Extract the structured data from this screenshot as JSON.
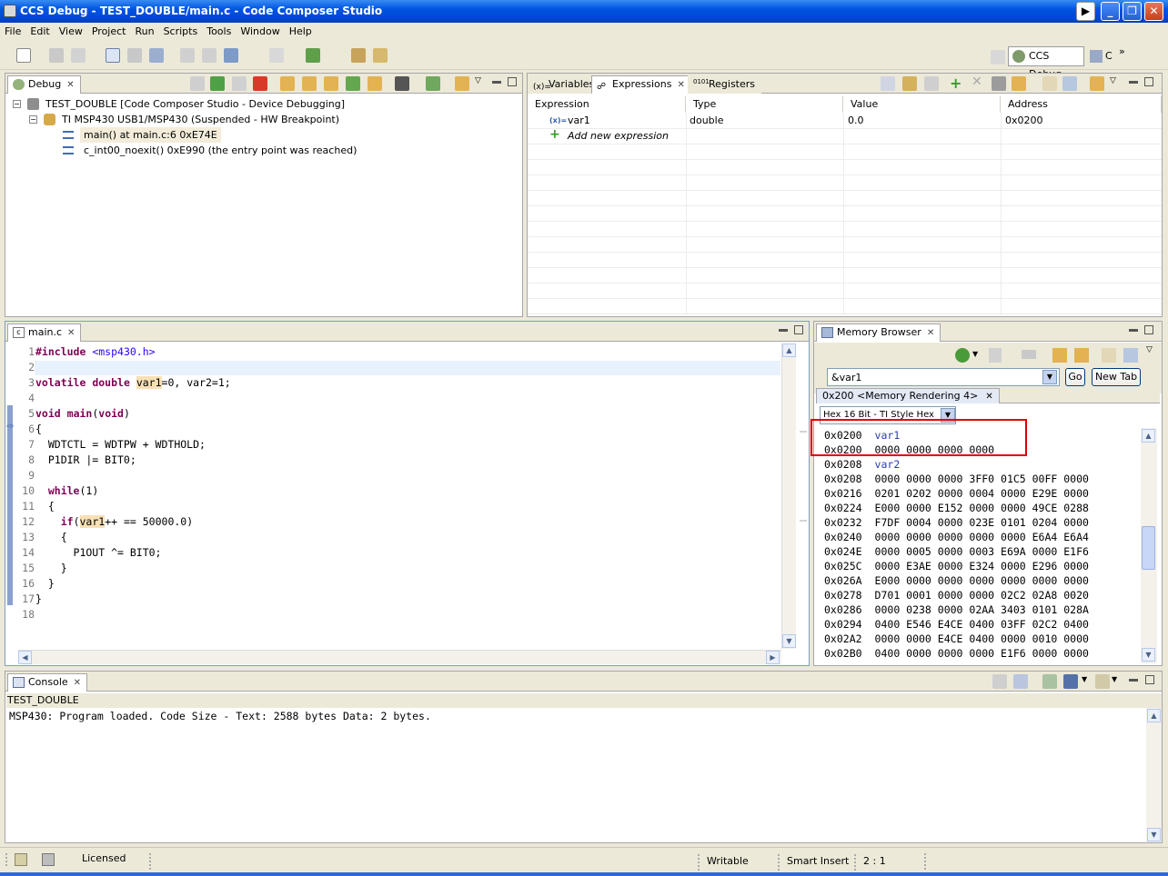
{
  "window": {
    "title": "CCS Debug - TEST_DOUBLE/main.c - Code Composer Studio"
  },
  "menu": [
    "File",
    "Edit",
    "View",
    "Project",
    "Run",
    "Scripts",
    "Tools",
    "Window",
    "Help"
  ],
  "perspective": {
    "label": "CCS Debug",
    "overflow": "C"
  },
  "debug": {
    "tab": "Debug",
    "items": [
      {
        "label": "TEST_DOUBLE [Code Composer Studio - Device Debugging]"
      },
      {
        "label": "TI MSP430 USB1/MSP430 (Suspended - HW Breakpoint)"
      },
      {
        "label": "main() at main.c:6 0xE74E"
      },
      {
        "label": "c_int00_noexit() 0xE990  (the entry point was reached)"
      }
    ]
  },
  "expressions": {
    "tabs": [
      "Variables",
      "Expressions",
      "Registers"
    ],
    "columns": [
      "Expression",
      "Type",
      "Value",
      "Address"
    ],
    "rows": [
      {
        "expr": "var1",
        "type": "double",
        "value": "0.0",
        "address": "0x0200"
      }
    ],
    "add_new": "Add new expression"
  },
  "editor": {
    "tab": "main.c",
    "lines": [
      {
        "n": "1",
        "t": "#include <msp430.h>"
      },
      {
        "n": "2",
        "t": ""
      },
      {
        "n": "3",
        "t": "volatile double var1=0, var2=1;"
      },
      {
        "n": "4",
        "t": ""
      },
      {
        "n": "5",
        "t": "void main(void)"
      },
      {
        "n": "6",
        "t": "{"
      },
      {
        "n": "7",
        "t": "  WDTCTL = WDTPW + WDTHOLD;"
      },
      {
        "n": "8",
        "t": "  P1DIR |= BIT0;"
      },
      {
        "n": "9",
        "t": ""
      },
      {
        "n": "10",
        "t": "  while(1)"
      },
      {
        "n": "11",
        "t": "  {"
      },
      {
        "n": "12",
        "t": "    if(var1++ == 50000.0)"
      },
      {
        "n": "13",
        "t": "    {"
      },
      {
        "n": "14",
        "t": "      P1OUT ^= BIT0;"
      },
      {
        "n": "15",
        "t": "    }"
      },
      {
        "n": "16",
        "t": "  }"
      },
      {
        "n": "17",
        "t": "}"
      },
      {
        "n": "18",
        "t": ""
      }
    ]
  },
  "memory": {
    "tab": "Memory Browser",
    "address_input": "&var1",
    "go": "Go",
    "new_tab": "New Tab",
    "rendering_tab": "0x200 <Memory Rendering 4>",
    "format": "Hex 16 Bit - TI Style Hex",
    "rows": [
      {
        "addr": "0x0200",
        "data": "var1",
        "sym": true
      },
      {
        "addr": "0x0200",
        "data": "0000 0000 0000 0000"
      },
      {
        "addr": "0x0208",
        "data": "var2",
        "sym": true
      },
      {
        "addr": "0x0208",
        "data": "0000 0000 0000 3FF0 01C5 00FF 0000"
      },
      {
        "addr": "0x0216",
        "data": "0201 0202 0000 0004 0000 E29E 0000"
      },
      {
        "addr": "0x0224",
        "data": "E000 0000 E152 0000 0000 49CE 0288"
      },
      {
        "addr": "0x0232",
        "data": "F7DF 0004 0000 023E 0101 0204 0000"
      },
      {
        "addr": "0x0240",
        "data": "0000 0000 0000 0000 0000 E6A4 E6A4"
      },
      {
        "addr": "0x024E",
        "data": "0000 0005 0000 0003 E69A 0000 E1F6"
      },
      {
        "addr": "0x025C",
        "data": "0000 E3AE 0000 E324 0000 E296 0000"
      },
      {
        "addr": "0x026A",
        "data": "E000 0000 0000 0000 0000 0000 0000"
      },
      {
        "addr": "0x0278",
        "data": "D701 0001 0000 0000 02C2 02A8 0020"
      },
      {
        "addr": "0x0286",
        "data": "0000 0238 0000 02AA 3403 0101 028A"
      },
      {
        "addr": "0x0294",
        "data": "0400 E546 E4CE 0400 03FF 02C2 0400"
      },
      {
        "addr": "0x02A2",
        "data": "0000 0000 E4CE 0400 0000 0010 0000"
      },
      {
        "addr": "0x02B0",
        "data": "0400 0000 0000 0000 E1F6 0000 0000"
      }
    ]
  },
  "console": {
    "tab": "Console",
    "project": "TEST_DOUBLE",
    "output": "MSP430: Program loaded. Code Size - Text: 2588 bytes Data: 2 bytes."
  },
  "status": {
    "license": "Licensed",
    "writable": "Writable",
    "insert": "Smart Insert",
    "position": "2 : 1"
  },
  "colors": {
    "highlight_box": "#e00000",
    "title_blue": "#0054e3",
    "keyword": "#7f0055"
  }
}
